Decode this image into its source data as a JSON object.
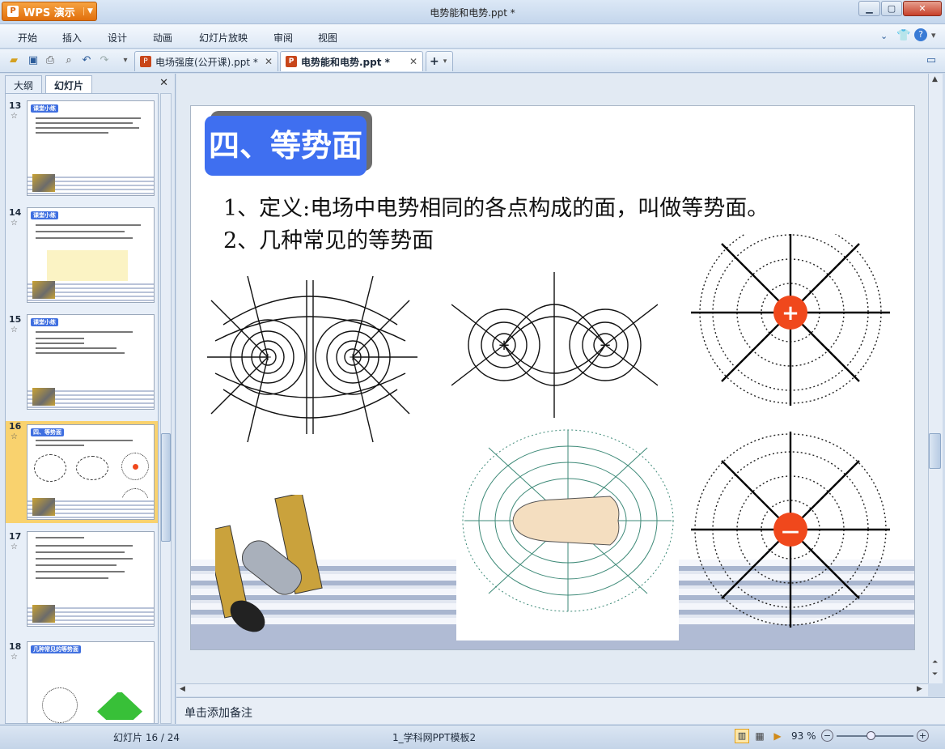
{
  "window": {
    "app_name": "WPS 演示",
    "title": "电势能和电势.ppt *"
  },
  "menu": [
    "开始",
    "插入",
    "设计",
    "动画",
    "幻灯片放映",
    "审阅",
    "视图"
  ],
  "tabs": [
    {
      "label": "电场强度(公开课).ppt *",
      "active": false
    },
    {
      "label": "电势能和电势.ppt *",
      "active": true
    }
  ],
  "left_pane": {
    "tabs": [
      "大纲",
      "幻灯片"
    ],
    "active_tab": "幻灯片",
    "slides": [
      {
        "num": "13",
        "title": "课堂小练"
      },
      {
        "num": "14",
        "title": "课堂小练"
      },
      {
        "num": "15",
        "title": "课堂小练"
      },
      {
        "num": "16",
        "title": "四、等势面",
        "selected": true
      },
      {
        "num": "17",
        "title": ""
      },
      {
        "num": "18",
        "title": "几种常见的等势面"
      }
    ]
  },
  "slide": {
    "title": "四、等势面",
    "line1": "1、定义:电场中电势相同的各点构成的面，叫做等势面。",
    "line2": "2、几种常见的等势面",
    "plus_sign": "+",
    "minus_sign": "—"
  },
  "notes_placeholder": "单击添加备注",
  "status": {
    "slide_info": "幻灯片 16 / 24",
    "template": "1_学科网PPT模板2",
    "zoom": "93 %"
  },
  "colors": {
    "accent": "#3f6ff0",
    "charge": "#f0481c",
    "app_orange": "#e8781a"
  }
}
